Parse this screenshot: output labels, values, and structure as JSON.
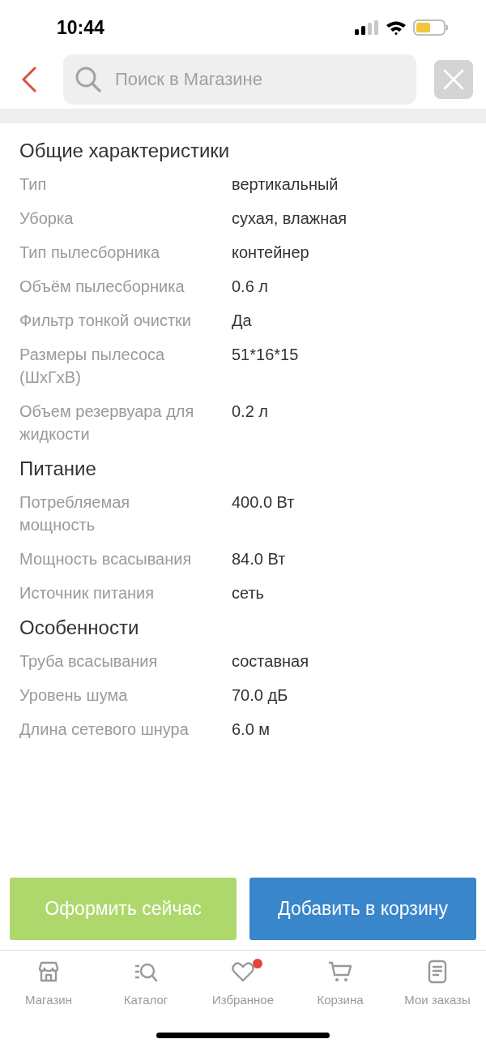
{
  "status_bar": {
    "time": "10:44"
  },
  "search": {
    "placeholder": "Поиск в Магазине"
  },
  "sections": [
    {
      "title": "Общие характеристики",
      "rows": [
        {
          "label": "Тип",
          "value": "вертикальный"
        },
        {
          "label": "Уборка",
          "value": "сухая, влажная"
        },
        {
          "label": "Тип пылесборника",
          "value": "контейнер"
        },
        {
          "label": "Объём пылесборника",
          "value": "0.6 л"
        },
        {
          "label": "Фильтр тонкой очистки",
          "value": "Да"
        },
        {
          "label": "Размеры пылесоса (ШхГхВ)",
          "value": "51*16*15"
        },
        {
          "label": "Объем резервуара для жидкости",
          "value": "0.2 л"
        }
      ]
    },
    {
      "title": "Питание",
      "rows": [
        {
          "label": "Потребляемая мощность",
          "value": "400.0 Вт"
        },
        {
          "label": "Мощность всасывания",
          "value": "84.0 Вт"
        },
        {
          "label": "Источник питания",
          "value": "сеть"
        }
      ]
    },
    {
      "title": "Особенности",
      "rows": [
        {
          "label": "Труба всасывания",
          "value": "составная"
        },
        {
          "label": "Уровень шума",
          "value": "70.0 дБ"
        },
        {
          "label": "Длина сетевого шнура",
          "value": "6.0 м"
        }
      ]
    }
  ],
  "actions": [
    {
      "label": "Оформить сейчас",
      "kind": "checkout"
    },
    {
      "label": "Добавить в корзину",
      "kind": "cart"
    }
  ],
  "tabs": [
    {
      "label": "Магазин",
      "kind": "store",
      "selected": false,
      "badge": false
    },
    {
      "label": "Каталог",
      "kind": "catalog",
      "selected": false,
      "badge": false
    },
    {
      "label": "Избранное",
      "kind": "favorites",
      "selected": false,
      "badge": true
    },
    {
      "label": "Корзина",
      "kind": "cart",
      "selected": false,
      "badge": false
    },
    {
      "label": "Мои заказы",
      "kind": "orders",
      "selected": false,
      "badge": false
    }
  ]
}
